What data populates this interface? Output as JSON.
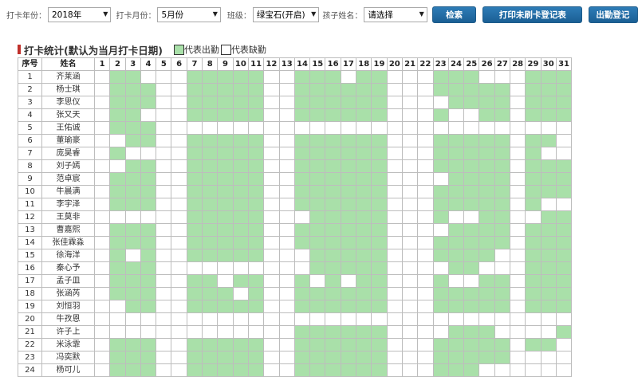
{
  "filters": {
    "year_label": "打卡年份：",
    "year_value": "2018年",
    "month_label": "打卡月份：",
    "month_value": "5月份",
    "class_label": "班级：",
    "class_value": "绿宝石(开启)",
    "child_label": "孩子姓名：",
    "child_value": "请选择"
  },
  "buttons": {
    "search": "检索",
    "print": "打印未刷卡登记表",
    "export": "出勤登记"
  },
  "stats": {
    "title": "打卡统计(默认为当月打卡日期)",
    "legend_present": "代表出勤",
    "legend_absent": "代表缺勤",
    "present_color": "#a9e0a9",
    "absent_color": "#ffffff"
  },
  "table": {
    "header_seq": "序号",
    "header_name": "姓名",
    "days": [
      "1",
      "2",
      "3",
      "4",
      "5",
      "6",
      "7",
      "8",
      "9",
      "10",
      "11",
      "12",
      "13",
      "14",
      "15",
      "16",
      "17",
      "18",
      "19",
      "20",
      "21",
      "22",
      "23",
      "24",
      "25",
      "26",
      "27",
      "28",
      "29",
      "30",
      "31"
    ],
    "rows": [
      {
        "seq": "1",
        "name": "齐莱涵",
        "marks": "0110001111100111011000111000111"
      },
      {
        "seq": "2",
        "name": "杨士琪",
        "marks": "0111001111100111111000111110111"
      },
      {
        "seq": "3",
        "name": "李思仪",
        "marks": "0111001111100111111000011110111"
      },
      {
        "seq": "4",
        "name": "张又天",
        "marks": "0110001111100111111000100110111"
      },
      {
        "seq": "5",
        "name": "王佑诚",
        "marks": "0111000000000000000000000000000"
      },
      {
        "seq": "6",
        "name": "董瑜豪",
        "marks": "0011001111100111111000111110110"
      },
      {
        "seq": "7",
        "name": "庞昊睿",
        "marks": "0100001111100111111000111110100"
      },
      {
        "seq": "8",
        "name": "刘子嫣",
        "marks": "0011001111100111111000111110111"
      },
      {
        "seq": "9",
        "name": "范卓宸",
        "marks": "0111001111100111111000011110111"
      },
      {
        "seq": "10",
        "name": "牛晨满",
        "marks": "0111001111100111111000111110111"
      },
      {
        "seq": "11",
        "name": "李宇泽",
        "marks": "0111001111100111111000111110100"
      },
      {
        "seq": "12",
        "name": "王莫非",
        "marks": "0000001111100011111000100110011"
      },
      {
        "seq": "13",
        "name": "曹嘉熙",
        "marks": "0111001111100111111000011110111"
      },
      {
        "seq": "14",
        "name": "张佳霖淼",
        "marks": "0111001111100111111000111110111"
      },
      {
        "seq": "15",
        "name": "徐海洋",
        "marks": "0101001111100011111000111100111"
      },
      {
        "seq": "16",
        "name": "秦心予",
        "marks": "0111000000000011111000011000111"
      },
      {
        "seq": "17",
        "name": "孟子皿",
        "marks": "0111001101100101011000100110111"
      },
      {
        "seq": "18",
        "name": "张涵芮",
        "marks": "0111001110100111111000111110111"
      },
      {
        "seq": "19",
        "name": "刘恒羽",
        "marks": "0011001111100111111000111110111"
      },
      {
        "seq": "20",
        "name": "牛孜恩",
        "marks": "0000000000000000000000000000000"
      },
      {
        "seq": "21",
        "name": "许子上",
        "marks": "0000000000000111111000011100001"
      },
      {
        "seq": "22",
        "name": "米泳霏",
        "marks": "0111001111100111111000111110110"
      },
      {
        "seq": "23",
        "name": "冯奕默",
        "marks": "0111001111100111111000111110000"
      },
      {
        "seq": "24",
        "name": "杨可儿",
        "marks": "0111001111100111111000111000000"
      }
    ]
  }
}
